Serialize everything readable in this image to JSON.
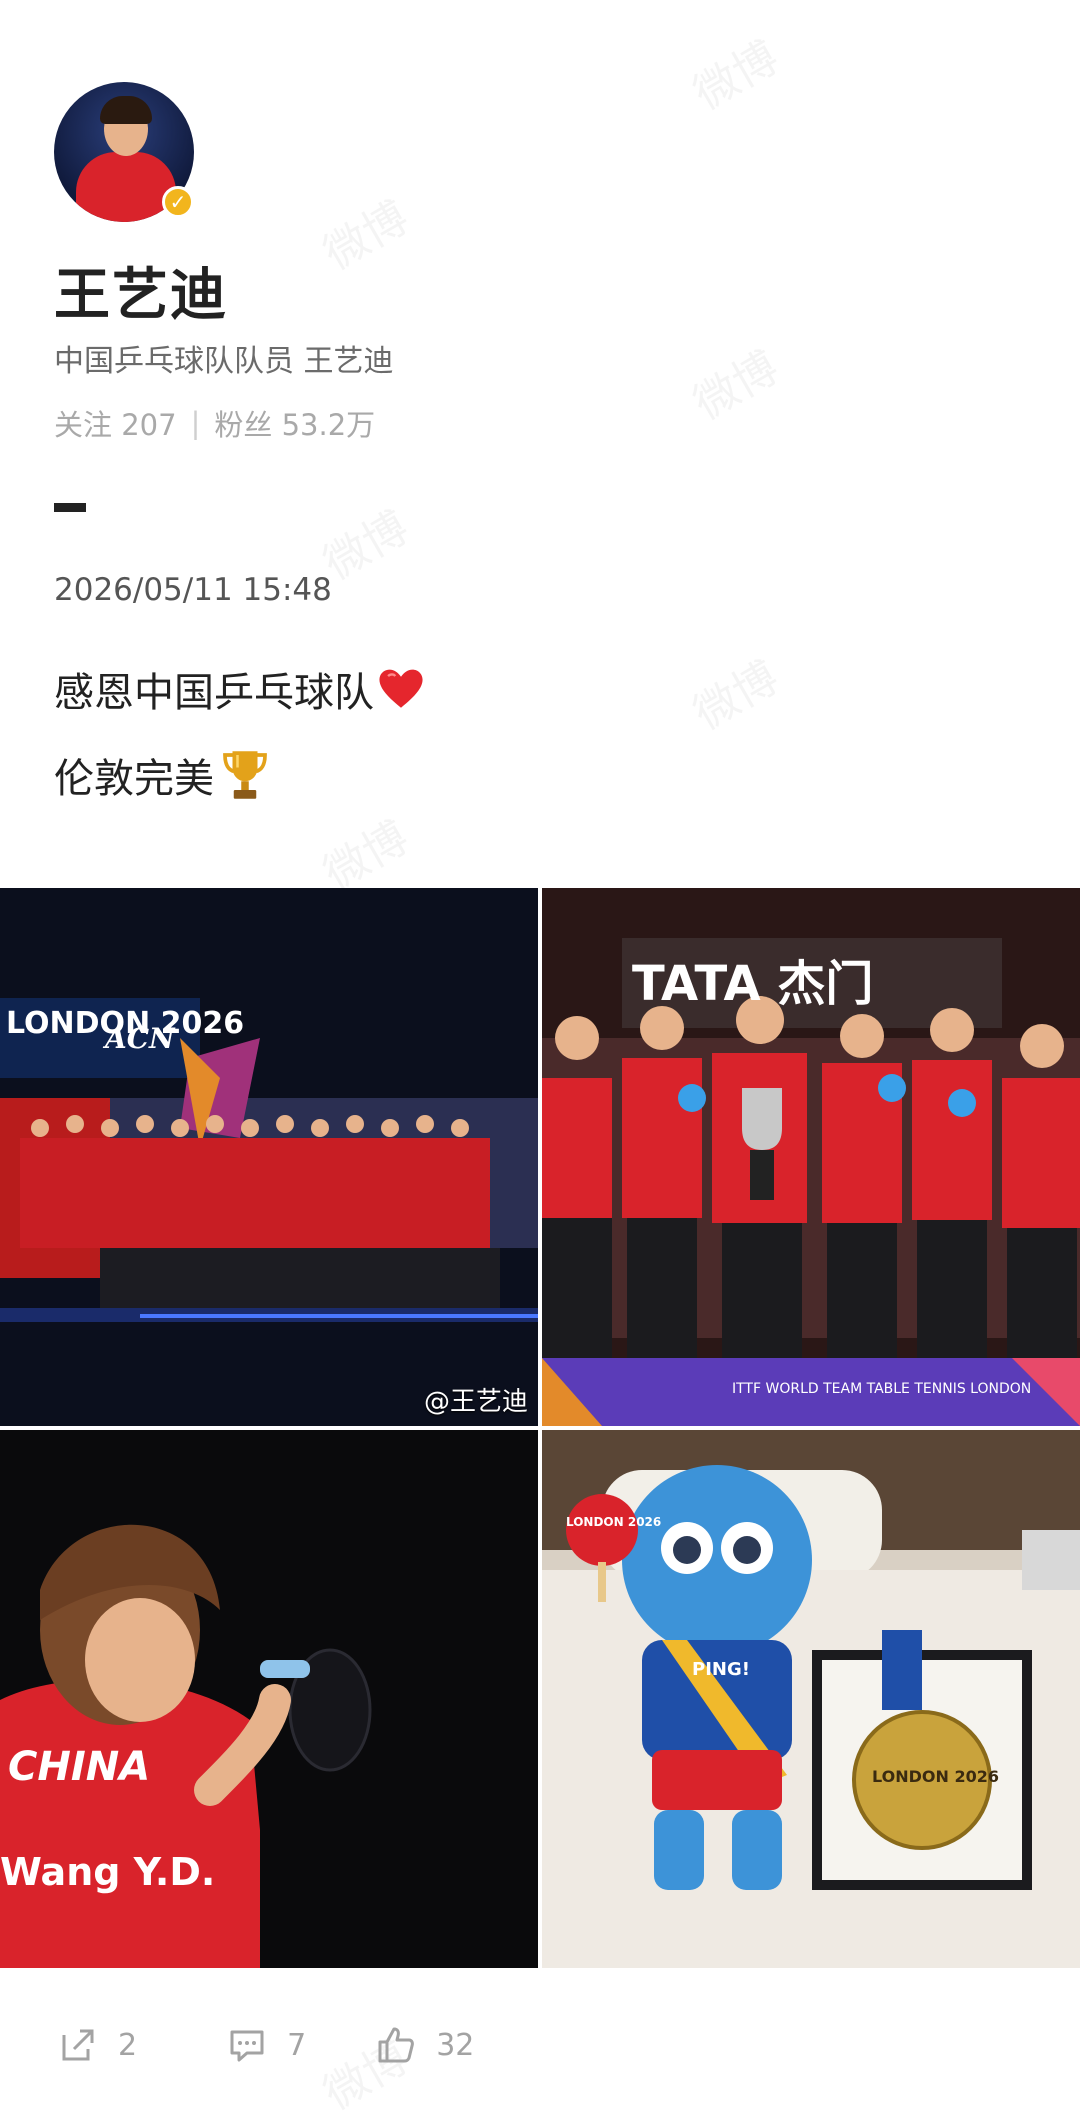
{
  "profile": {
    "name": "王艺迪",
    "bio": "中国乒乓球队队员 王艺迪",
    "following_label": "关注 207",
    "followers_label": "粉丝 53.2万",
    "verified_icon": "verified-badge-icon"
  },
  "post": {
    "timestamp": "2026/05/11 15:48",
    "line1": "感恩中国乒乓球队",
    "line2": "伦敦完美",
    "emoji1": "red-heart-icon",
    "emoji2": "trophy-icon"
  },
  "images": {
    "watermark_tag": "@王艺迪",
    "watermark_text": "微博",
    "photo1": {
      "banner": "LONDON 2026",
      "sponsor": "ACN"
    },
    "photo2": {
      "banner": "TATA 杰门",
      "bottom_banner": "ITTF WORLD TEAM TABLE TENNIS LONDON"
    },
    "photo3": {
      "jersey_line1": "CHINA",
      "jersey_line2": "Wang Y.D."
    },
    "photo4": {
      "paddle_text": "LONDON 2026",
      "shirt_text": "PING!",
      "medal_text": "LONDON 2026"
    }
  },
  "actions": {
    "share_count": "2",
    "comment_count": "7",
    "like_count": "32"
  },
  "colors": {
    "accent_red": "#d9232b",
    "verified_gold": "#f2b51d",
    "muted_text": "#a9a9a9"
  }
}
